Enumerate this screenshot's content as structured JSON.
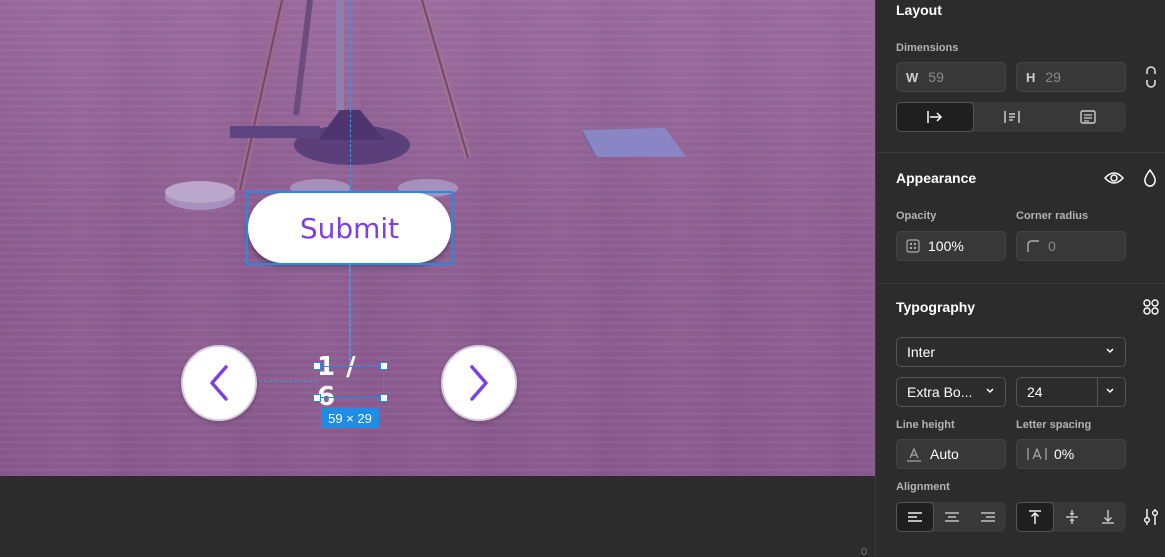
{
  "canvas": {
    "submit_label": "Submit",
    "counter_text": "1 / 6",
    "selection_size": "59 × 29",
    "stray_digit": "0"
  },
  "layout": {
    "title": "Layout",
    "dimensions_label": "Dimensions",
    "width_prefix": "W",
    "width_value": "59",
    "height_prefix": "H",
    "height_value": "29"
  },
  "appearance": {
    "title": "Appearance",
    "opacity_label": "Opacity",
    "opacity_value": "100%",
    "corner_radius_label": "Corner radius",
    "corner_radius_value": "0"
  },
  "typography": {
    "title": "Typography",
    "font_family": "Inter",
    "font_weight": "Extra Bo...",
    "font_size": "24",
    "line_height_label": "Line height",
    "line_height_value": "Auto",
    "letter_spacing_label": "Letter spacing",
    "letter_spacing_value": "0%",
    "alignment_label": "Alignment"
  },
  "colors": {
    "accent": "#7b3fe4",
    "selection": "#1f8ce6",
    "panel_bg": "#2c2c2c"
  }
}
